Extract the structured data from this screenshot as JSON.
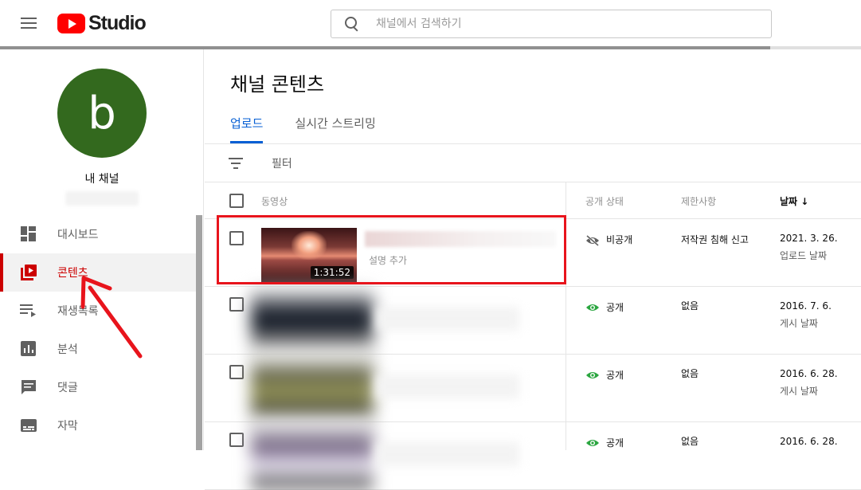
{
  "header": {
    "logo_text": "Studio",
    "search_placeholder": "채널에서 검색하기"
  },
  "sidebar": {
    "avatar_letter": "b",
    "channel_name": "내 채널",
    "items": [
      {
        "label": "대시보드",
        "icon": "dashboard-icon"
      },
      {
        "label": "콘텐츠",
        "icon": "content-icon",
        "active": true
      },
      {
        "label": "재생목록",
        "icon": "playlist-icon"
      },
      {
        "label": "분석",
        "icon": "analytics-icon"
      },
      {
        "label": "댓글",
        "icon": "comments-icon"
      },
      {
        "label": "자막",
        "icon": "subtitles-icon"
      }
    ]
  },
  "main": {
    "title": "채널 콘텐츠",
    "tabs": [
      "업로드",
      "실시간 스트리밍"
    ],
    "filter_label": "필터",
    "columns": {
      "video": "동영상",
      "visibility": "공개 상태",
      "restrictions": "제한사항",
      "date": "날짜 ↓"
    },
    "rows": [
      {
        "duration": "1:31:52",
        "description": "설명 추가",
        "visibility": "비공개",
        "restriction": "저작권 침해 신고",
        "date": "2021. 3. 26.",
        "date_label": "업로드 날짜"
      },
      {
        "visibility": "공개",
        "restriction": "없음",
        "date": "2016. 7. 6.",
        "date_label": "게시 날짜"
      },
      {
        "visibility": "공개",
        "restriction": "없음",
        "date": "2016. 6. 28.",
        "date_label": "게시 날짜"
      },
      {
        "visibility": "공개",
        "restriction": "없음",
        "date": "2016. 6. 28.",
        "date_label": ""
      }
    ]
  },
  "colors": {
    "accent": "#065fd4",
    "brand": "#ff0000",
    "active_nav": "#cc0000",
    "visible_icon": "#2ba640",
    "annotation": "#e8141c"
  }
}
